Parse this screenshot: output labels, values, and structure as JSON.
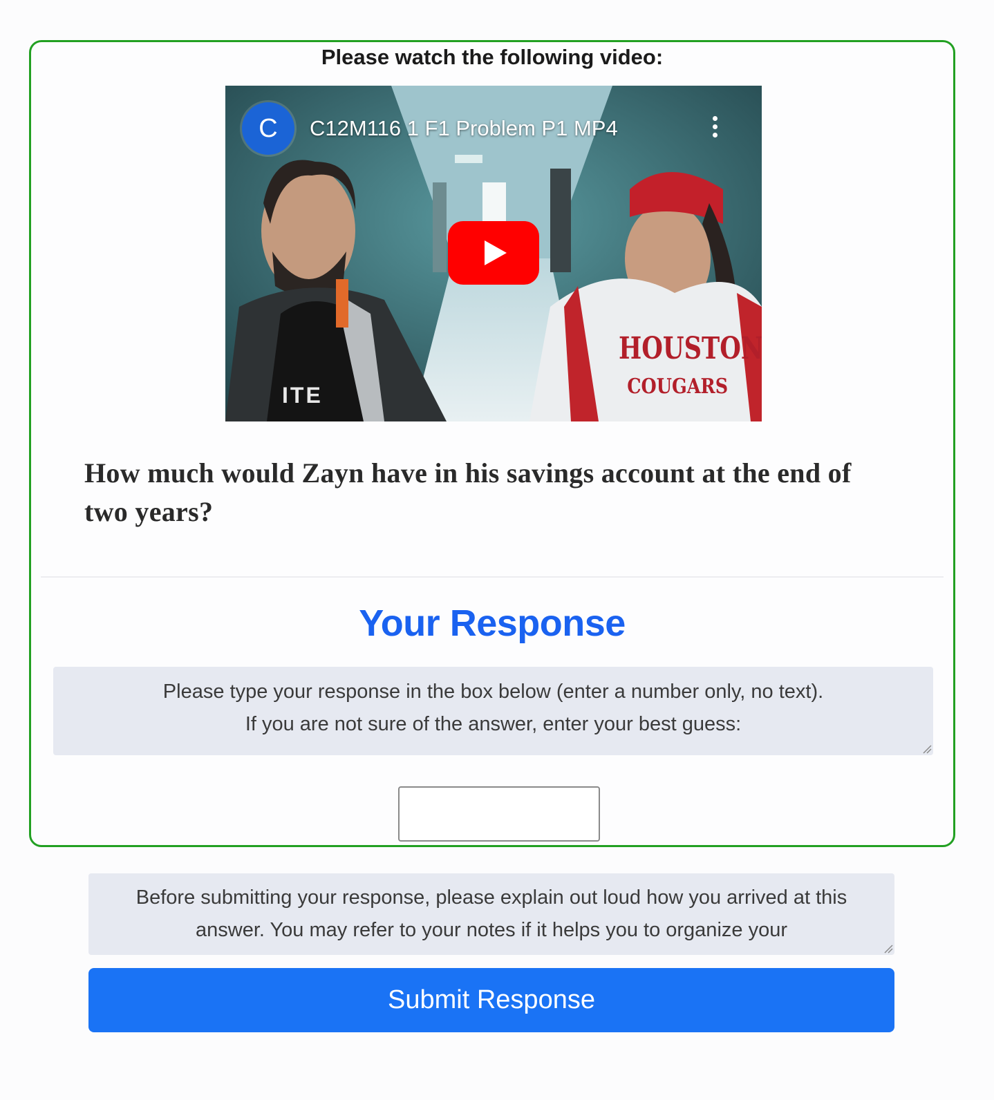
{
  "instruction": "Please watch the following video:",
  "video": {
    "channel_initial": "C",
    "title": "C12M116 1 F1 Problem P1 MP4",
    "menu_icon": "kebab-menu-icon",
    "play_icon": "youtube-play-icon",
    "shirt_text_line1": "HOUSTON",
    "shirt_text_line2": "COUGARS",
    "shirt_text_left": "ITE"
  },
  "question": "How much would Zayn have in his savings account at the end of two years?",
  "response": {
    "title": "Your Response",
    "prompt_line1": "Please type your response in the box below (enter a number only, no text).",
    "prompt_line2": "If you are not sure of the answer, enter your best guess:",
    "input_value": ""
  },
  "explain_text": "Before submitting your response, please explain out loud how you arrived at this answer. You may refer to your notes if it helps you to organize your",
  "submit_label": "Submit Response",
  "colors": {
    "card_border": "#22a022",
    "accent": "#1a62f0",
    "button": "#1a73f5",
    "prompt_bg": "#e6e9f1",
    "youtube_red": "#ff0000"
  }
}
